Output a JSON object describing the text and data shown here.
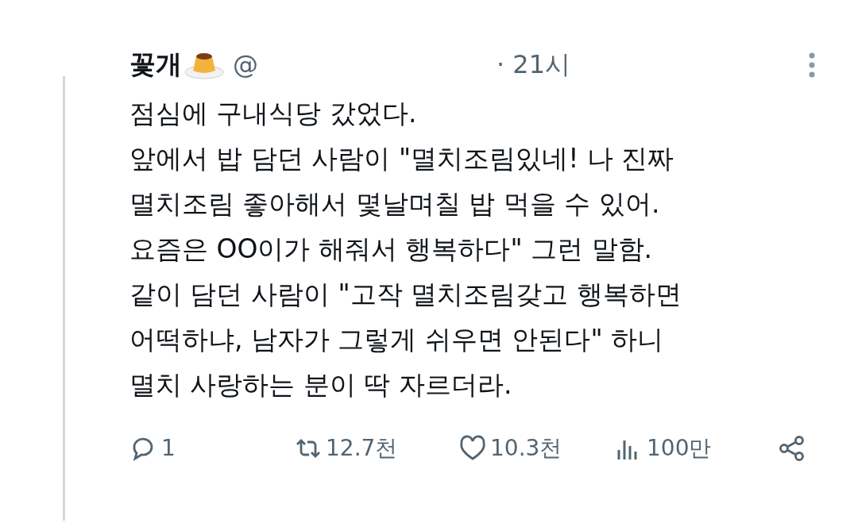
{
  "post": {
    "author": "꽃개",
    "handle": "@",
    "time": "· 21시",
    "lines": [
      "점심에 구내식당 갔었다.",
      "앞에서 밥 담던 사람이 \"멸치조림있네! 나 진짜",
      "멸치조림 좋아해서 몇날며칠 밥 먹을 수 있어.",
      "요즘은 OO이가 해줘서 행복하다\" 그런 말함.",
      "같이 담던 사람이 \"고작 멸치조림갖고 행복하면",
      "어떡하냐, 남자가 그렇게 쉬우면 안된다\" 하니",
      "멸치 사랑하는 분이 딱 자르더라."
    ],
    "actions": [
      {
        "kind": "reply",
        "count": "1"
      },
      {
        "kind": "repost",
        "count": "12.7천"
      },
      {
        "kind": "like",
        "count": "10.3천"
      },
      {
        "kind": "views",
        "count": "100만"
      },
      {
        "kind": "share"
      }
    ]
  }
}
